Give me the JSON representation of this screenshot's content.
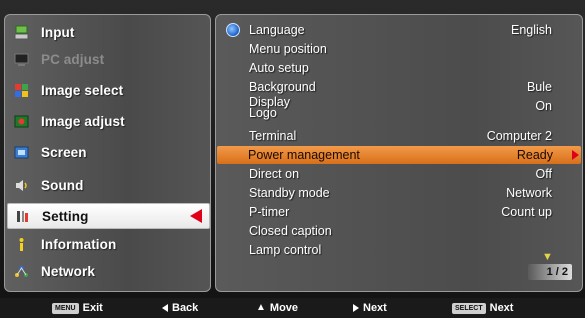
{
  "sidebar": {
    "items": [
      {
        "label": "Input",
        "icon": "input-icon",
        "state": "normal"
      },
      {
        "label": "PC adjust",
        "icon": "pc-adjust-icon",
        "state": "disabled"
      },
      {
        "label": "Image select",
        "icon": "image-select-icon",
        "state": "normal"
      },
      {
        "label": "Image adjust",
        "icon": "image-adjust-icon",
        "state": "normal"
      },
      {
        "label": "Screen",
        "icon": "screen-icon",
        "state": "normal"
      },
      {
        "label": "Sound",
        "icon": "sound-icon",
        "state": "normal"
      },
      {
        "label": "Setting",
        "icon": "setting-icon",
        "state": "active"
      },
      {
        "label": "Information",
        "icon": "information-icon",
        "state": "normal"
      },
      {
        "label": "Network",
        "icon": "network-icon",
        "state": "normal"
      }
    ]
  },
  "settings": {
    "rows": [
      {
        "label": "Language",
        "value": "English"
      },
      {
        "label": "Menu position",
        "value": ""
      },
      {
        "label": "Auto setup",
        "value": ""
      },
      {
        "label": "Background",
        "value": "Bule"
      },
      {
        "label": "Display",
        "label2": "Logo",
        "value": "On"
      },
      {
        "label": "Terminal",
        "value": "Computer 2"
      },
      {
        "label": "Power management",
        "value": "Ready"
      },
      {
        "label": "Direct on",
        "value": "Off"
      },
      {
        "label": "Standby mode",
        "value": "Network"
      },
      {
        "label": "P-timer",
        "value": "Count up"
      },
      {
        "label": "Closed caption",
        "value": ""
      },
      {
        "label": "Lamp control",
        "value": ""
      }
    ],
    "page_indicator": "1 / 2"
  },
  "footer": {
    "exit_key": "MENU",
    "exit_label": "Exit",
    "back_label": "Back",
    "move_label": "Move",
    "next_label": "Next",
    "select_key": "SELECT",
    "select_label": "Next"
  },
  "colors": {
    "highlight": "#e07a28",
    "active_arrow": "#e0001a"
  }
}
